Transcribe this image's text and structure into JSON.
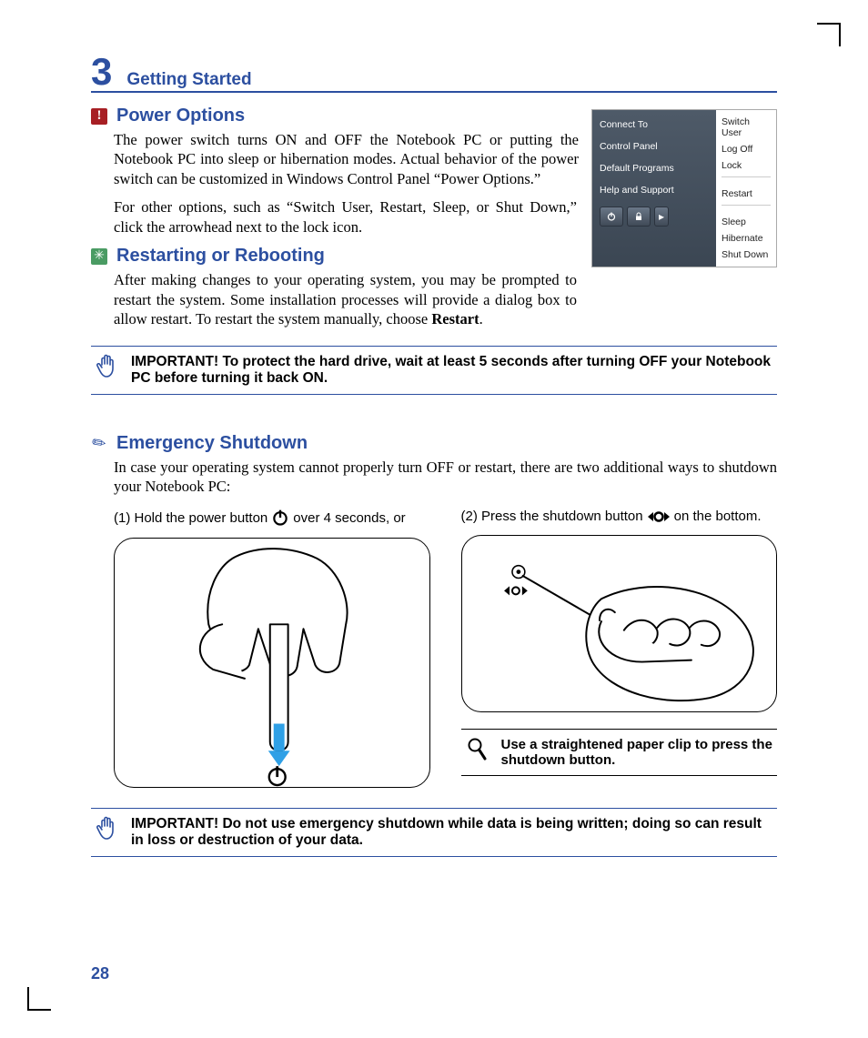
{
  "chapter": {
    "number": "3",
    "title": "Getting Started"
  },
  "sections": {
    "power_options": {
      "title": "Power Options",
      "p1": "The power switch turns ON and OFF the Notebook PC or putting the Notebook PC into sleep or hiberna­tion modes. Actual behavior of the power switch can be customized in Windows Control Panel “Power Options.”",
      "p2": "For other options, such as “Switch User, Restart, Sleep, or Shut Down,” click the arrowhead next to the lock icon."
    },
    "restart": {
      "title": "Restarting or Rebooting",
      "p1_a": "After making changes to your operating system, you may be prompted to restart the system. Some installation processes will provide a dialog box to allow restart. To restart the system manually, choose ",
      "p1_bold": "Restart",
      "p1_b": "."
    },
    "emergency": {
      "title": "Emergency Shutdown",
      "p1": "In case your operating system cannot properly turn OFF or restart, there are two additional ways to shutdown your Notebook PC:",
      "step1_a": "(1) Hold the power button ",
      "step1_b": " over 4 seconds, or",
      "step2_a": "(2) Press the shutdown button ",
      "step2_b": " on the bottom."
    }
  },
  "callouts": {
    "important1": "IMPORTANT!  To protect the hard drive, wait at least 5 seconds after turning OFF your Notebook PC before turning it back ON.",
    "tip": "Use a straightened paper clip to press the shutdown button.",
    "important2": "IMPORTANT!  Do not use emergency shutdown while data is being written; doing so can result in loss or destruction of your data."
  },
  "vista_menu": {
    "left": [
      "Connect To",
      "Control Panel",
      "Default Programs",
      "Help and Support"
    ],
    "right_top": [
      "Switch User",
      "Log Off",
      "Lock"
    ],
    "right_mid": [
      "Restart"
    ],
    "right_bot": [
      "Sleep",
      "Hibernate",
      "Shut Down"
    ]
  },
  "page_number": "28"
}
